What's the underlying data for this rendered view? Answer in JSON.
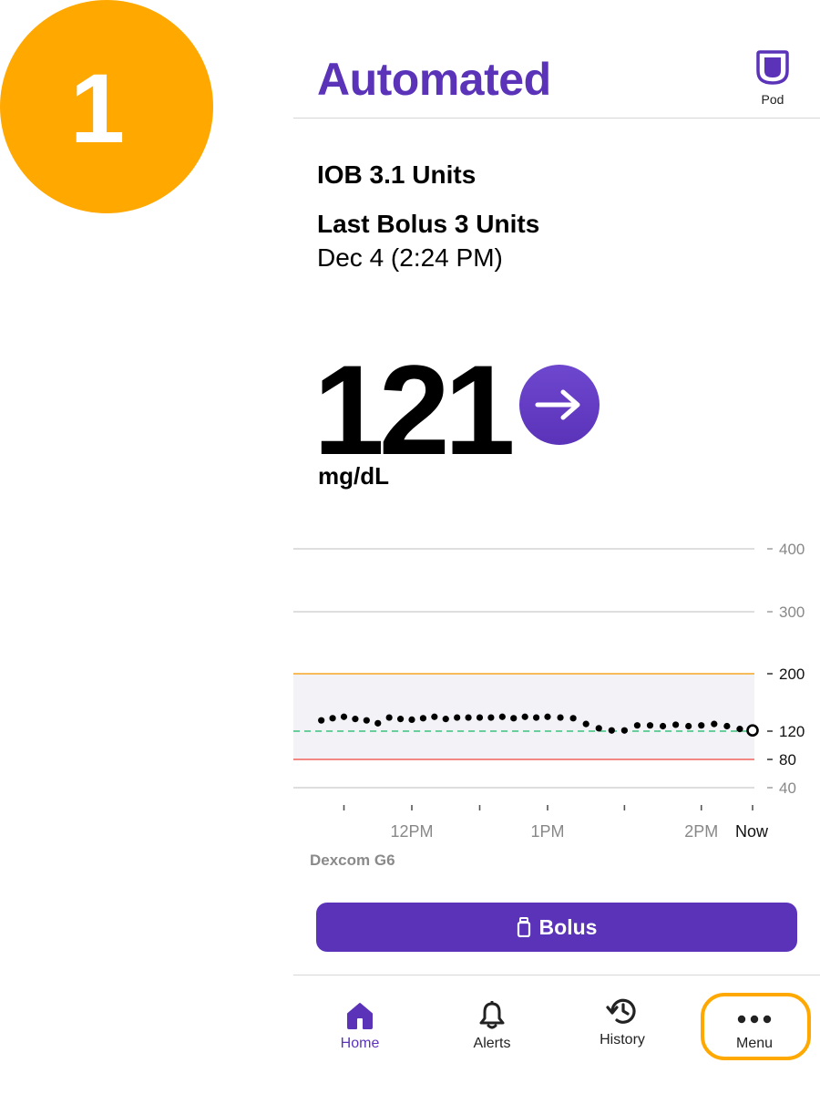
{
  "step": {
    "number": "1"
  },
  "header": {
    "mode_title": "Automated",
    "pod_label": "Pod"
  },
  "status": {
    "iob": "IOB 3.1 Units",
    "last_bolus": "Last Bolus 3 Units",
    "last_bolus_time": "Dec 4 (2:24 PM)"
  },
  "glucose": {
    "value": "121",
    "unit": "mg/dL",
    "trend_icon": "arrow-right-icon"
  },
  "chart_data": {
    "type": "scatter",
    "xlabel": "",
    "ylabel": "",
    "x_tick_labels": [
      "12PM",
      "1PM",
      "2PM",
      "Now"
    ],
    "y_tick_labels": [
      "400",
      "300",
      "200",
      "120",
      "80",
      "40"
    ],
    "ylim": [
      40,
      400
    ],
    "target_range": [
      80,
      200
    ],
    "target_line": 120,
    "grid": true,
    "points": [
      {
        "x": "11:20",
        "y": 135
      },
      {
        "x": "11:25",
        "y": 138
      },
      {
        "x": "11:30",
        "y": 140
      },
      {
        "x": "11:35",
        "y": 137
      },
      {
        "x": "11:40",
        "y": 135
      },
      {
        "x": "11:45",
        "y": 131
      },
      {
        "x": "11:50",
        "y": 139
      },
      {
        "x": "11:55",
        "y": 137
      },
      {
        "x": "12:00",
        "y": 136
      },
      {
        "x": "12:05",
        "y": 138
      },
      {
        "x": "12:10",
        "y": 140
      },
      {
        "x": "12:15",
        "y": 137
      },
      {
        "x": "12:20",
        "y": 139
      },
      {
        "x": "12:25",
        "y": 139
      },
      {
        "x": "12:30",
        "y": 139
      },
      {
        "x": "12:35",
        "y": 139
      },
      {
        "x": "12:40",
        "y": 140
      },
      {
        "x": "12:45",
        "y": 138
      },
      {
        "x": "12:50",
        "y": 140
      },
      {
        "x": "12:55",
        "y": 139
      },
      {
        "x": "13:00",
        "y": 140
      },
      {
        "x": "13:05",
        "y": 139
      },
      {
        "x": "13:10",
        "y": 138
      },
      {
        "x": "13:15",
        "y": 130
      },
      {
        "x": "13:20",
        "y": 124
      },
      {
        "x": "13:25",
        "y": 121
      },
      {
        "x": "13:30",
        "y": 121
      },
      {
        "x": "13:35",
        "y": 128
      },
      {
        "x": "13:40",
        "y": 128
      },
      {
        "x": "13:45",
        "y": 127
      },
      {
        "x": "13:50",
        "y": 129
      },
      {
        "x": "13:55",
        "y": 127
      },
      {
        "x": "14:00",
        "y": 128
      },
      {
        "x": "14:05",
        "y": 130
      },
      {
        "x": "14:10",
        "y": 127
      },
      {
        "x": "14:15",
        "y": 123
      },
      {
        "x": "14:20",
        "y": 121
      }
    ],
    "colors": {
      "high_line": "#F5A623",
      "low_line": "#F0645A",
      "target_line": "#3FBF7F",
      "range_fill": "#F3F2F7"
    }
  },
  "sensor": {
    "name": "Dexcom G6"
  },
  "bolus_button": {
    "label": "Bolus"
  },
  "nav": {
    "items": [
      {
        "label": "Home",
        "icon": "home-icon",
        "active": true
      },
      {
        "label": "Alerts",
        "icon": "bell-icon"
      },
      {
        "label": "History",
        "icon": "history-icon"
      },
      {
        "label": "Menu",
        "icon": "more-dots-icon"
      }
    ]
  },
  "colors": {
    "brand": "#5A33B9",
    "highlight": "#FFA800"
  }
}
